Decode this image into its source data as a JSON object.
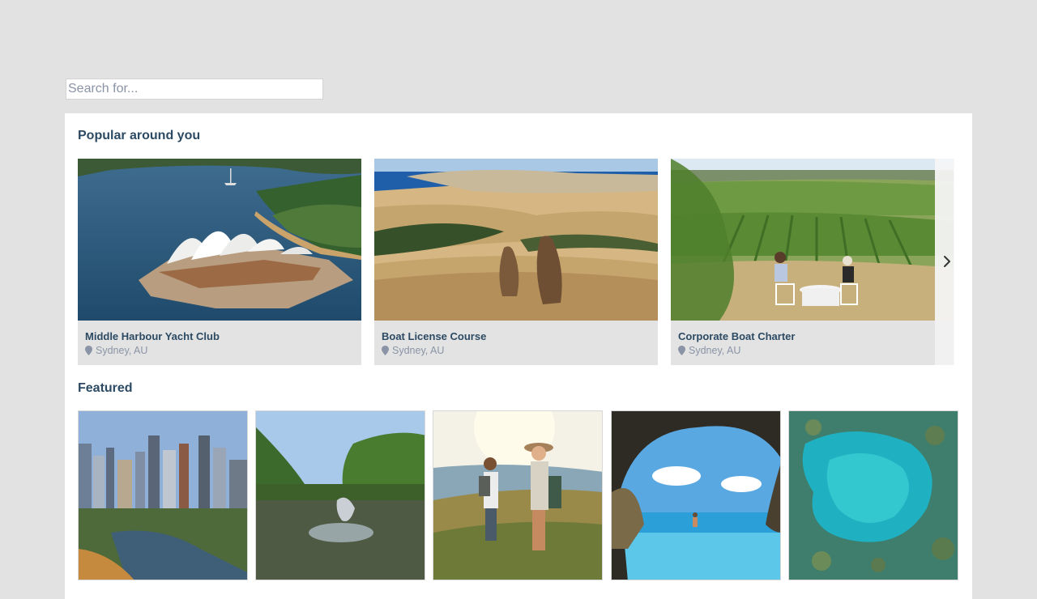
{
  "search": {
    "placeholder": "Search for..."
  },
  "popular": {
    "title": "Popular around you",
    "cards": [
      {
        "title": "Middle Harbour Yacht Club",
        "location": "Sydney, AU",
        "image": "opera-house-harbour"
      },
      {
        "title": "Boat License Course",
        "location": "Sydney, AU",
        "image": "kangaroos-coast"
      },
      {
        "title": "Corporate Boat Charter",
        "location": "Sydney, AU",
        "image": "vineyard-picnic"
      }
    ],
    "next_icon": "chevron-right-icon"
  },
  "featured": {
    "title": "Featured",
    "tiles": [
      {
        "image": "city-river-skyline"
      },
      {
        "image": "fish-jumping-river"
      },
      {
        "image": "hikers-coast"
      },
      {
        "image": "sea-cave-beach"
      },
      {
        "image": "aerial-reef"
      }
    ]
  },
  "colors": {
    "title": "#2c4a63",
    "muted": "#8a94a6",
    "card_bg": "#e3e3e3",
    "page_bg": "#e2e2e2"
  }
}
